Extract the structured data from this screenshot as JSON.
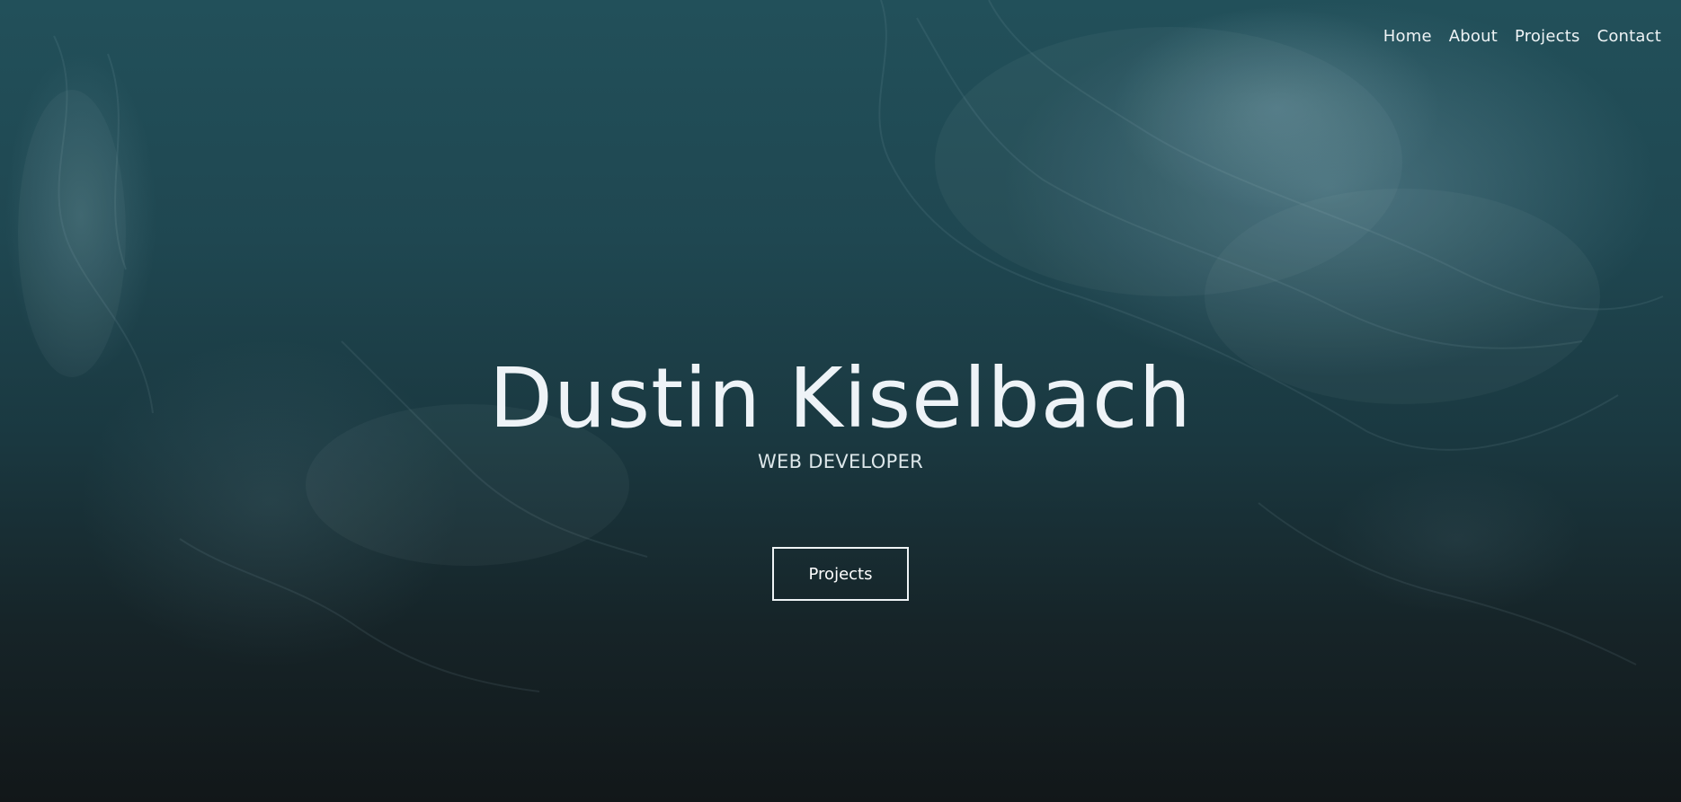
{
  "nav": {
    "items": [
      {
        "label": "Home"
      },
      {
        "label": "About"
      },
      {
        "label": "Projects"
      },
      {
        "label": "Contact"
      }
    ]
  },
  "hero": {
    "name": "Dustin Kiselbach",
    "role": "WEB DEVELOPER",
    "button_label": "Projects"
  },
  "colors": {
    "text": "#eef3f5",
    "background_top": "#22505a",
    "background_bottom": "#121719"
  }
}
